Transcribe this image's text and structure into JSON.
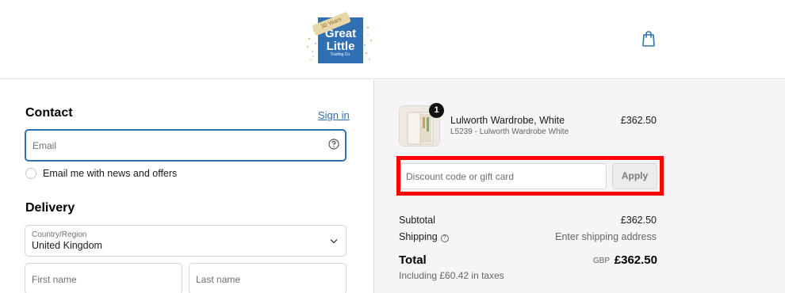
{
  "header": {
    "logo": {
      "ribbon": "30 Years",
      "line1": "Great",
      "line2": "Little",
      "line3": "Trading Co."
    },
    "cart_icon": "shopping-bag-icon"
  },
  "contact": {
    "title": "Contact",
    "sign_in": "Sign in",
    "email_placeholder": "Email",
    "newsletter_label": "Email me with news and offers"
  },
  "delivery": {
    "title": "Delivery",
    "country_label": "Country/Region",
    "country_value": "United Kingdom",
    "first_name_placeholder": "First name",
    "last_name_placeholder": "Last name"
  },
  "order": {
    "item": {
      "quantity": "1",
      "name": "Lulworth Wardrobe, White",
      "variant": "L5239 - Lulworth Wardrobe White",
      "price": "£362.50"
    },
    "discount_placeholder": "Discount code or gift card",
    "apply_label": "Apply",
    "subtotal_label": "Subtotal",
    "subtotal_value": "£362.50",
    "shipping_label": "Shipping",
    "shipping_value": "Enter shipping address",
    "total_label": "Total",
    "total_currency": "GBP",
    "total_value": "£362.50",
    "tax_note": "Including £60.42 in taxes"
  },
  "colors": {
    "accent": "#2f6fb3",
    "highlight": "#ff0000",
    "panel": "#f5f5f5"
  }
}
